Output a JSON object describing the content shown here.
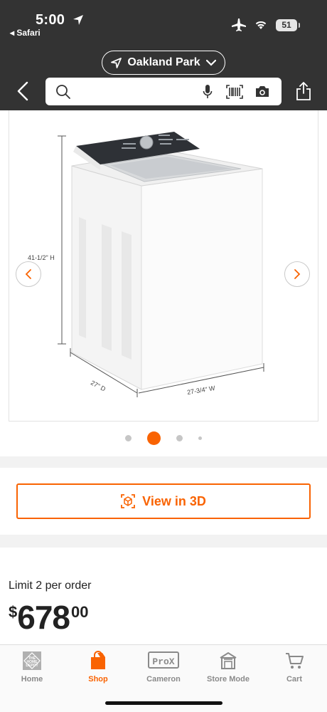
{
  "status_bar": {
    "time": "5:00",
    "back_app": "◂ Safari",
    "battery": "51"
  },
  "header": {
    "location": "Oakland Park",
    "search_placeholder": ""
  },
  "product_image": {
    "dimensions": {
      "height": "41-1/2\" H",
      "depth": "27\" D",
      "width": "27-3/4\" W"
    },
    "carousel": {
      "total": 4,
      "active_index": 1
    }
  },
  "view3d": {
    "label": "View in 3D"
  },
  "pricing": {
    "limit_text": "Limit 2 per order",
    "dollar_sign": "$",
    "dollars": "678",
    "cents": "00"
  },
  "tabbar": {
    "tabs": [
      {
        "label": "Home",
        "icon": "home-depot-logo-icon",
        "active": false
      },
      {
        "label": "Shop",
        "icon": "shop-bag-icon",
        "active": true
      },
      {
        "label": "Cameron",
        "icon": "prox-badge-icon",
        "active": false
      },
      {
        "label": "Store Mode",
        "icon": "store-icon",
        "active": false
      },
      {
        "label": "Cart",
        "icon": "cart-icon",
        "active": false
      }
    ],
    "prox_badge": "ProX",
    "home_badge": "THE HOME DEPOT"
  },
  "colors": {
    "brand_orange": "#f96302",
    "header_bg": "#333333"
  }
}
